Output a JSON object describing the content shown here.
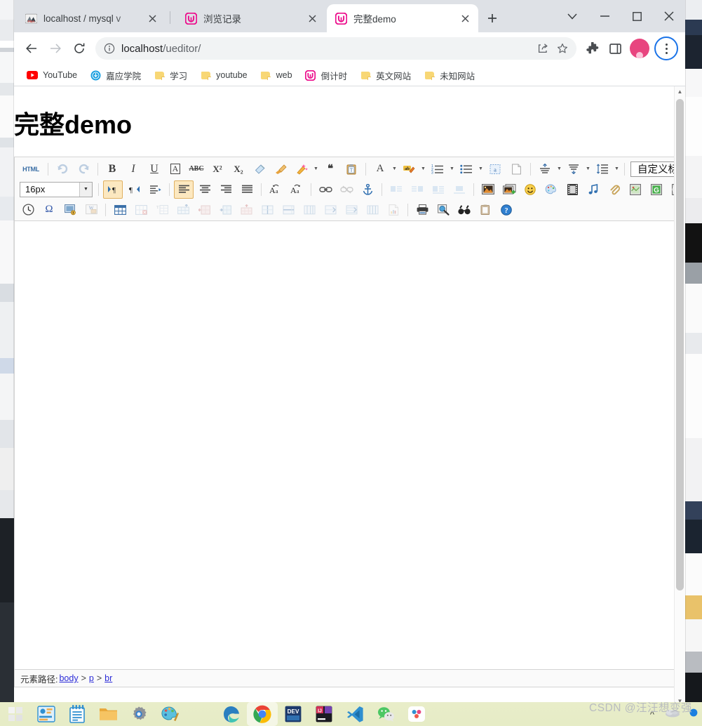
{
  "browser": {
    "tabs": [
      {
        "title": "localhost / mysql v",
        "favicon": "phpmyadmin-icon",
        "active": false
      },
      {
        "title": "浏览记录",
        "favicon": "ueditor-icon",
        "active": false
      },
      {
        "title": "完整demo",
        "favicon": "ueditor-icon",
        "active": true
      }
    ],
    "new_tab_label": "+",
    "window_controls": {
      "tabsearch": "chevron-down-icon",
      "minimize": "−",
      "maximize": "▢",
      "close": "✕"
    },
    "nav": {
      "back": "←",
      "forward": "→",
      "reload": "⟳"
    },
    "omnibox": {
      "info_icon": "info-icon",
      "url_host": "localhost",
      "url_path": "/ueditor/",
      "share_icon": "share-icon",
      "bookmark_icon": "star-icon"
    },
    "toolbar_icons": {
      "extensions": "puzzle-icon",
      "sidepanel": "side-panel-icon",
      "profile": "avatar-icon",
      "menu": "kebab-menu-icon"
    },
    "bookmarks": [
      {
        "label": "YouTube",
        "icon": "youtube-icon"
      },
      {
        "label": "嘉应学院",
        "icon": "globe-icon"
      },
      {
        "label": "学习",
        "icon": "folder-icon"
      },
      {
        "label": "youtube",
        "icon": "folder-icon"
      },
      {
        "label": "web",
        "icon": "folder-icon"
      },
      {
        "label": "倒计时",
        "icon": "ueditor-icon"
      },
      {
        "label": "英文网站",
        "icon": "folder-icon"
      },
      {
        "label": "未知网站",
        "icon": "folder-icon"
      }
    ]
  },
  "page": {
    "heading": "完整demo"
  },
  "editor": {
    "toolbar_row1": [
      {
        "name": "source-code-button",
        "glyph": "HTML",
        "kind": "text",
        "state": "normal"
      },
      {
        "name": "separator",
        "kind": "sep"
      },
      {
        "name": "undo-button",
        "glyph": "↶",
        "kind": "icon",
        "state": "disabled"
      },
      {
        "name": "redo-button",
        "glyph": "↷",
        "kind": "icon",
        "state": "disabled"
      },
      {
        "name": "separator",
        "kind": "sep"
      },
      {
        "name": "bold-button",
        "glyph": "B",
        "kind": "bold",
        "state": "normal"
      },
      {
        "name": "italic-button",
        "glyph": "I",
        "kind": "italic",
        "state": "normal"
      },
      {
        "name": "underline-button",
        "glyph": "U",
        "kind": "underline",
        "state": "normal"
      },
      {
        "name": "text-border-button",
        "glyph": "A",
        "kind": "boxed",
        "state": "normal"
      },
      {
        "name": "strikethrough-button",
        "glyph": "ABC",
        "kind": "strike",
        "state": "normal"
      },
      {
        "name": "superscript-button",
        "glyph": "X²",
        "kind": "sup",
        "state": "normal"
      },
      {
        "name": "subscript-button",
        "glyph": "X₂",
        "kind": "sub",
        "state": "normal"
      },
      {
        "name": "remove-format-button",
        "glyph": "eraser-icon",
        "kind": "img",
        "state": "normal"
      },
      {
        "name": "format-match-button",
        "glyph": "brush-icon",
        "kind": "img",
        "state": "normal"
      },
      {
        "name": "auto-typeset-button",
        "glyph": "wand-icon",
        "kind": "img",
        "state": "split"
      },
      {
        "name": "blockquote-button",
        "glyph": "❝",
        "kind": "quote",
        "state": "normal"
      },
      {
        "name": "paste-plain-button",
        "glyph": "clipboard-icon",
        "kind": "img",
        "state": "normal"
      },
      {
        "name": "separator",
        "kind": "sep"
      },
      {
        "name": "font-color-button",
        "glyph": "A",
        "kind": "fontcolor",
        "state": "split"
      },
      {
        "name": "back-color-button",
        "glyph": "ab-icon",
        "kind": "backcolor",
        "state": "split"
      },
      {
        "name": "ordered-list-button",
        "glyph": "numlist-icon",
        "kind": "olist",
        "state": "split"
      },
      {
        "name": "unordered-list-button",
        "glyph": "bullist-icon",
        "kind": "ulist",
        "state": "split"
      },
      {
        "name": "anchor-link-button",
        "glyph": "a-dotted-icon",
        "kind": "img",
        "state": "normal"
      },
      {
        "name": "page-break-button",
        "glyph": "page-icon",
        "kind": "img",
        "state": "normal"
      },
      {
        "name": "separator",
        "kind": "sep"
      },
      {
        "name": "row-spacing-top-button",
        "glyph": "rowtop-icon",
        "kind": "img",
        "state": "split"
      },
      {
        "name": "row-spacing-bottom-button",
        "glyph": "rowbottom-icon",
        "kind": "img",
        "state": "split"
      },
      {
        "name": "line-height-button",
        "glyph": "lineheight-icon",
        "kind": "img",
        "state": "split"
      },
      {
        "name": "separator",
        "kind": "sep"
      }
    ],
    "custom_title_value": "自定义标题",
    "font_size_value": "16px",
    "toolbar_row2": [
      {
        "name": "indent-right-button",
        "glyph": "indentr-icon",
        "state": "on"
      },
      {
        "name": "indent-left-button",
        "glyph": "indentl-icon",
        "state": "normal"
      },
      {
        "name": "paragraph-indent-button",
        "glyph": "pindent-icon",
        "state": "normal"
      },
      {
        "name": "separator",
        "kind": "sep"
      },
      {
        "name": "align-left-button",
        "glyph": "alignl-icon",
        "state": "on"
      },
      {
        "name": "align-center-button",
        "glyph": "alignc-icon",
        "state": "normal"
      },
      {
        "name": "align-right-button",
        "glyph": "alignr-icon",
        "state": "normal"
      },
      {
        "name": "align-justify-button",
        "glyph": "alignj-icon",
        "state": "normal"
      },
      {
        "name": "separator",
        "kind": "sep"
      },
      {
        "name": "to-traditional-button",
        "glyph": "Aa-icon",
        "state": "normal"
      },
      {
        "name": "to-simplified-button",
        "glyph": "aA-icon",
        "state": "normal"
      },
      {
        "name": "separator",
        "kind": "sep"
      },
      {
        "name": "insert-link-button",
        "glyph": "link-icon",
        "state": "normal"
      },
      {
        "name": "unlink-button",
        "glyph": "unlink-icon",
        "state": "disabled"
      },
      {
        "name": "anchor-button",
        "glyph": "anchor-icon",
        "state": "normal"
      },
      {
        "name": "separator",
        "kind": "sep"
      },
      {
        "name": "image-float-left-button",
        "glyph": "imgleft-icon",
        "state": "disabled"
      },
      {
        "name": "image-float-right-button",
        "glyph": "imgright-icon",
        "state": "disabled"
      },
      {
        "name": "image-float-none-button",
        "glyph": "imgnone-icon",
        "state": "disabled"
      },
      {
        "name": "image-center-button",
        "glyph": "imgcenter-icon",
        "state": "disabled"
      },
      {
        "name": "separator",
        "kind": "sep"
      },
      {
        "name": "insert-image-button",
        "glyph": "picture-icon",
        "state": "normal"
      },
      {
        "name": "image-manager-button",
        "glyph": "pictures-icon",
        "state": "normal"
      },
      {
        "name": "emotion-button",
        "glyph": "smiley-icon",
        "state": "normal"
      },
      {
        "name": "scrawl-button",
        "glyph": "palette-icon",
        "state": "normal"
      },
      {
        "name": "insert-video-button",
        "glyph": "film-icon",
        "state": "normal"
      },
      {
        "name": "music-button",
        "glyph": "music-icon",
        "state": "normal"
      },
      {
        "name": "attachment-button",
        "glyph": "clip-icon",
        "state": "normal"
      },
      {
        "name": "map-button",
        "glyph": "map-icon",
        "state": "normal"
      },
      {
        "name": "gmap-button",
        "glyph": "gmap-icon",
        "state": "normal"
      },
      {
        "name": "webapp-button",
        "glyph": "webapp-icon",
        "state": "normal"
      }
    ],
    "toolbar_row3": [
      {
        "name": "insert-date-button",
        "glyph": "clock-icon",
        "state": "normal"
      },
      {
        "name": "special-character-button",
        "glyph": "Ω",
        "state": "normal"
      },
      {
        "name": "snapscreen-button",
        "glyph": "snapscreen-icon",
        "state": "normal"
      },
      {
        "name": "word-image-button",
        "glyph": "wordimg-icon",
        "state": "disabled"
      },
      {
        "name": "separator",
        "kind": "sep"
      },
      {
        "name": "insert-table-button",
        "glyph": "table-icon",
        "state": "normal"
      },
      {
        "name": "delete-table-button",
        "glyph": "deltable-icon",
        "state": "disabled"
      },
      {
        "name": "table-props-button",
        "glyph": "tableprops-icon",
        "state": "disabled"
      },
      {
        "name": "insert-row-button",
        "glyph": "insrow-icon",
        "state": "disabled"
      },
      {
        "name": "insert-col-button",
        "glyph": "inscol-icon",
        "state": "disabled"
      },
      {
        "name": "merge-right-button",
        "glyph": "mergeright-icon",
        "state": "disabled"
      },
      {
        "name": "merge-down-button",
        "glyph": "mergedown-icon",
        "state": "disabled"
      },
      {
        "name": "split-cell-button",
        "glyph": "splitcell-icon",
        "state": "disabled"
      },
      {
        "name": "split-rows-button",
        "glyph": "splitrow-icon",
        "state": "disabled"
      },
      {
        "name": "split-cols-button",
        "glyph": "splitcol-icon",
        "state": "disabled"
      },
      {
        "name": "delete-row-button",
        "glyph": "delrow-icon",
        "state": "disabled"
      },
      {
        "name": "delete-col-button",
        "glyph": "delcol-icon",
        "state": "disabled"
      },
      {
        "name": "table-sort-button",
        "glyph": "tablesort-icon",
        "state": "disabled"
      },
      {
        "name": "chart-button",
        "glyph": "chart-icon",
        "state": "disabled"
      },
      {
        "name": "separator",
        "kind": "sep"
      },
      {
        "name": "print-button",
        "glyph": "printer-icon",
        "state": "normal"
      },
      {
        "name": "preview-button",
        "glyph": "preview-icon",
        "state": "normal"
      },
      {
        "name": "search-replace-button",
        "glyph": "binoculars-icon",
        "state": "normal"
      },
      {
        "name": "paste-button",
        "glyph": "paste-icon",
        "state": "normal"
      },
      {
        "name": "help-button",
        "glyph": "help-icon",
        "state": "normal"
      }
    ],
    "status": {
      "label": "元素路径:",
      "path": [
        "body",
        "p",
        "br"
      ],
      "separator": ">"
    }
  },
  "taskbar": {
    "items": [
      {
        "name": "start-button",
        "icon": "windows-icon"
      },
      {
        "name": "taskview-button",
        "icon": "taskview-icon"
      },
      {
        "name": "notepad-app",
        "icon": "notepad-icon"
      },
      {
        "name": "file-explorer-app",
        "icon": "folder-icon"
      },
      {
        "name": "settings-app",
        "icon": "gear-icon"
      },
      {
        "name": "paint-app",
        "icon": "paint-icon"
      },
      {
        "name": "calculator-app",
        "icon": "calculator-icon"
      },
      {
        "name": "edge-app",
        "icon": "edge-icon"
      },
      {
        "name": "chrome-app",
        "icon": "chrome-icon",
        "active": true
      },
      {
        "name": "devcpp-app",
        "icon": "devcpp-icon"
      },
      {
        "name": "intellij-app",
        "icon": "intellij-icon"
      },
      {
        "name": "vscode-app",
        "icon": "vscode-icon"
      },
      {
        "name": "wechat-app",
        "icon": "wechat-icon"
      },
      {
        "name": "baidunetdisk-app",
        "icon": "baidunetdisk-icon"
      }
    ],
    "tray": {
      "chevron": "^",
      "weather": "cloud-icon",
      "dot": "blue-dot"
    }
  },
  "watermark": "CSDN @汪汪想变强"
}
